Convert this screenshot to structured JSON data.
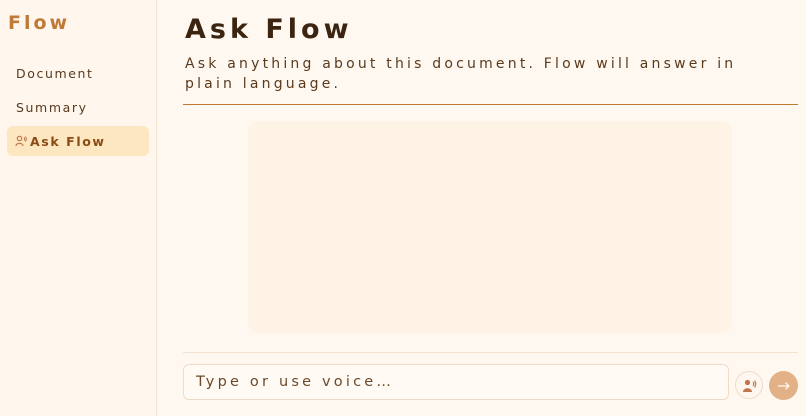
{
  "app": {
    "name": "Flow"
  },
  "sidebar": {
    "items": [
      {
        "label": "Document",
        "active": false
      },
      {
        "label": "Summary",
        "active": false
      },
      {
        "label": "Ask Flow",
        "active": true,
        "icon": "speaker-person-icon"
      }
    ]
  },
  "main": {
    "title": "Ask Flow",
    "subtitle": "Ask anything about this document. Flow will answer in plain language."
  },
  "composer": {
    "placeholder": "Type or use voice…",
    "value": "",
    "voice_icon": "voice-person-icon",
    "send_icon": "arrow-right-icon"
  },
  "colors": {
    "accent": "#c07a36",
    "active_bg": "#fde7c1",
    "send_bg": "#e2b185"
  }
}
